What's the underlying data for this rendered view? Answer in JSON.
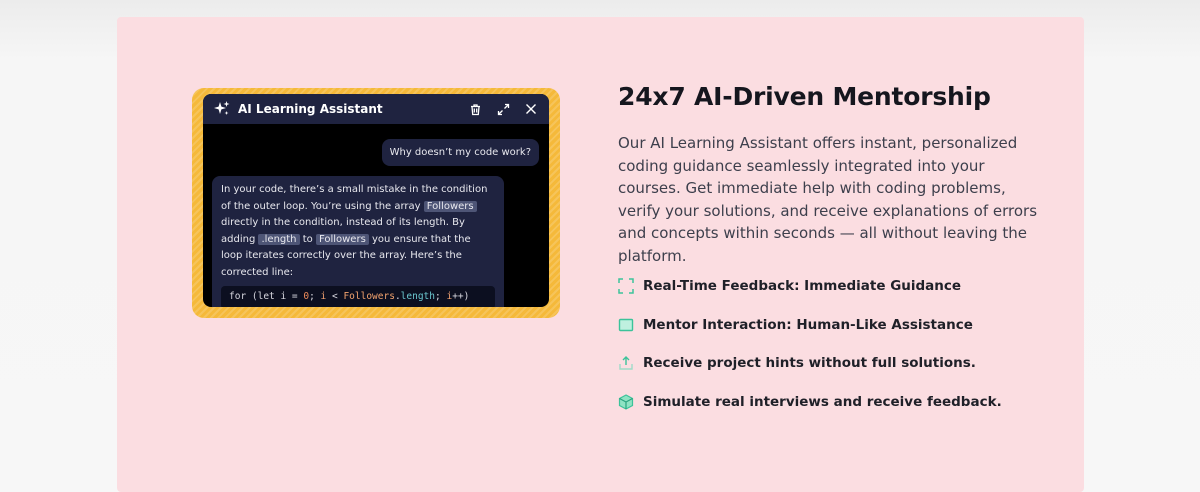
{
  "chat": {
    "title": "AI Learning Assistant",
    "user_message": "Why doesn’t my code work?",
    "ai_segments": {
      "s1": "In your code, there’s a small mistake in the condition of the outer loop. You’re using the array ",
      "hl1": "Followers",
      "s2": " directly in the condition, instead of its length. By adding ",
      "hl2": ".length",
      "s3": " to ",
      "hl3": "Followers",
      "s4": " you ensure that the loop iterates correctly over the array. Here’s the corrected line:"
    },
    "code": {
      "p1": "for (let i = ",
      "num": "0",
      "p2": "; ",
      "v1": "i",
      "p3": " < ",
      "arr": "Followers",
      "dot": ".",
      "prop": "length",
      "p4": "; ",
      "v2": "i",
      "p5": "++)"
    }
  },
  "section": {
    "heading": "24x7 AI-Driven Mentorship",
    "description": "Our AI Learning Assistant offers instant, personalized coding guidance seamlessly integrated into your courses. Get immediate help with coding problems, verify your solutions, and receive explanations of errors and concepts within seconds — all without leaving the platform."
  },
  "features": [
    {
      "label": "Real-Time Feedback: Immediate Guidance",
      "icon": "scan-icon"
    },
    {
      "label": "Mentor Interaction: Human-Like Assistance",
      "icon": "screen-icon"
    },
    {
      "label": "Receive project hints without full solutions.",
      "icon": "upload-icon"
    },
    {
      "label": "Simulate real interviews and receive feedback.",
      "icon": "cube-icon"
    }
  ],
  "colors": {
    "panel_bg": "#fbdde1",
    "accent_yellow": "#f5b93a",
    "chat_header": "#1f2340",
    "feature_icon": "#3cc39a"
  }
}
